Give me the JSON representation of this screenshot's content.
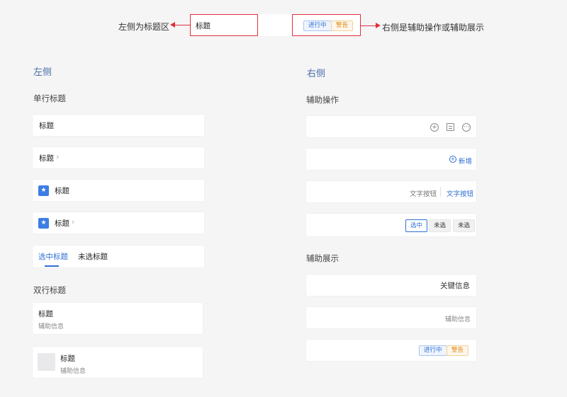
{
  "annotation": {
    "title_sample": "标题",
    "left_label": "左侧为标题区",
    "right_label": "右侧是辅助操作或辅助展示",
    "tags": [
      "进行中",
      "警告"
    ]
  },
  "left": {
    "heading": "左侧",
    "single_line": {
      "heading": "单行标题",
      "rows": [
        {
          "title": "标题"
        },
        {
          "title": "标题",
          "chevron": "›"
        },
        {
          "title": "标题"
        },
        {
          "title": "标题",
          "chevron": "›"
        }
      ],
      "tabs": {
        "selected": "选中标题",
        "unselected": "未选标题"
      }
    },
    "double_line": {
      "heading": "双行标题",
      "rows": [
        {
          "title": "标题",
          "subtitle": "辅助信息"
        },
        {
          "title": "标题",
          "subtitle": "辅助信息"
        }
      ]
    }
  },
  "right": {
    "heading": "右侧",
    "actions": {
      "heading": "辅助操作",
      "icons": [
        "add-circle-icon",
        "calendar-icon",
        "more-circle-icon"
      ],
      "add_label": "新增",
      "text_button_grey": "文字按钮",
      "text_button_blue": "文字按钮",
      "chips": [
        "选中",
        "未选",
        "未选"
      ]
    },
    "display": {
      "heading": "辅助展示",
      "key_info": "关键信息",
      "aux_info": "辅助信息",
      "tags": [
        "进行中",
        "警告"
      ]
    }
  },
  "colors": {
    "accent": "#2f6fd4",
    "annotation_red": "#e0303a",
    "tag_orange": "#e08a17",
    "heading_blue": "#4a6fa5"
  }
}
